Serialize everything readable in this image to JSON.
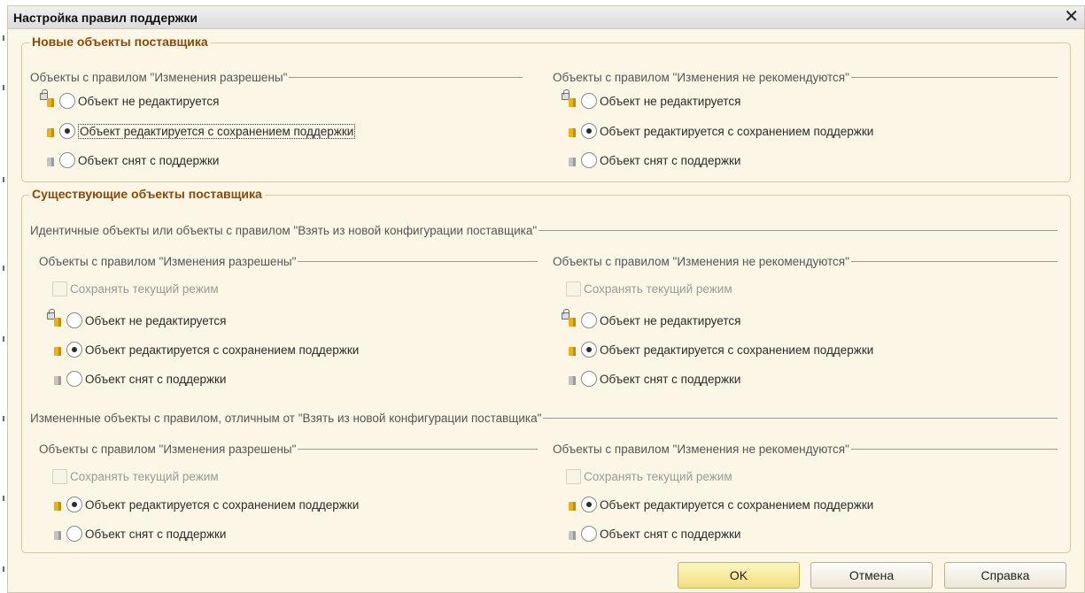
{
  "dialog": {
    "title": "Настройка правил поддержки",
    "close_label": "✕"
  },
  "new_objects": {
    "title": "Новые объекты поставщика",
    "left": {
      "header": "Объекты с правилом \"Изменения разрешены\"",
      "options": [
        "Объект не редактируется",
        "Объект редактируется с сохранением поддержки",
        "Объект снят с поддержки"
      ],
      "selected": 1
    },
    "right": {
      "header": "Объекты с правилом \"Изменения не рекомендуются\"",
      "options": [
        "Объект не редактируется",
        "Объект редактируется с сохранением поддержки",
        "Объект снят с поддержки"
      ],
      "selected": 1
    }
  },
  "existing_objects": {
    "title": "Существующие объекты поставщика",
    "identical": {
      "header": "Идентичные объекты или объекты с правилом \"Взять из новой конфигурации поставщика\"",
      "left": {
        "header": "Объекты с правилом \"Изменения разрешены\"",
        "keep_mode": "Сохранять текущий режим",
        "options": [
          "Объект не редактируется",
          "Объект редактируется с сохранением поддержки",
          "Объект снят с поддержки"
        ],
        "selected": 1
      },
      "right": {
        "header": "Объекты с правилом \"Изменения не рекомендуются\"",
        "keep_mode": "Сохранять текущий режим",
        "options": [
          "Объект не редактируется",
          "Объект редактируется с сохранением поддержки",
          "Объект снят с поддержки"
        ],
        "selected": 1
      }
    },
    "modified": {
      "header": "Измененные объекты с правилом, отличным от \"Взять из новой конфигурации поставщика\"",
      "left": {
        "header": "Объекты с правилом \"Изменения разрешены\"",
        "keep_mode": "Сохранять текущий режим",
        "options": [
          "Объект редактируется с сохранением поддержки",
          "Объект снят с поддержки"
        ],
        "selected": 0
      },
      "right": {
        "header": "Объекты с правилом \"Изменения не рекомендуются\"",
        "keep_mode": "Сохранять текущий режим",
        "options": [
          "Объект редактируется с сохранением поддержки",
          "Объект снят с поддержки"
        ],
        "selected": 0
      }
    }
  },
  "buttons": {
    "ok": "OK",
    "cancel": "Отмена",
    "help": "Справка"
  }
}
